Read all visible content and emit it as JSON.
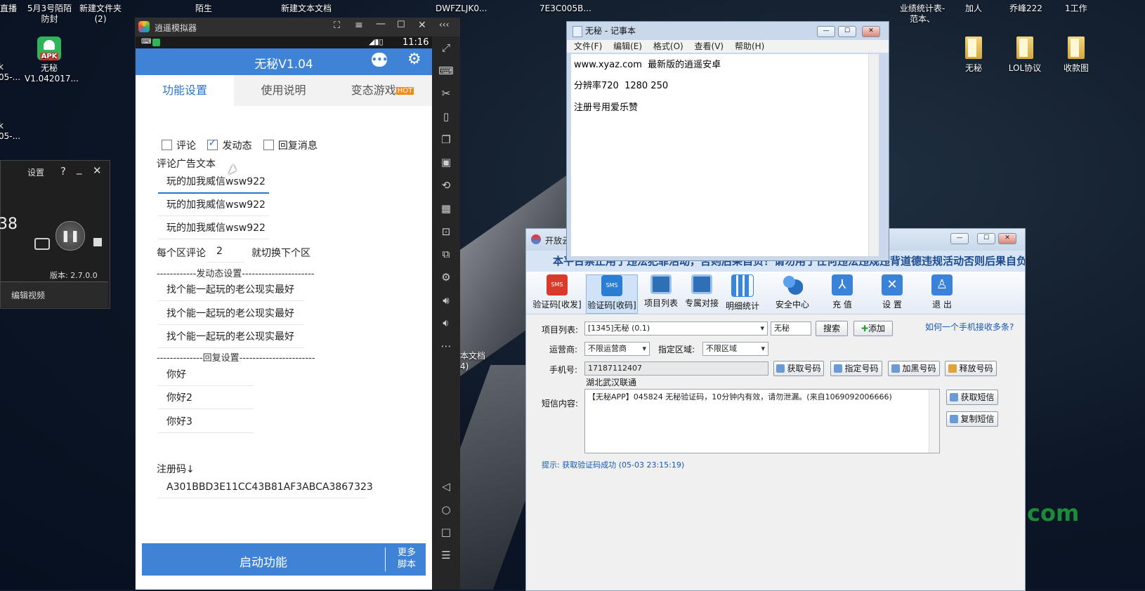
{
  "desktop": {
    "top_labels": [
      "直播",
      "5月3号陌陌\n防封",
      "新建文件夹\n(2)",
      "陌生",
      "新建文本文档",
      "DWFZLJK0...",
      "7E3C005B...",
      "业绩统计表-\n范本、",
      "加人",
      "乔峰222",
      "1工作"
    ],
    "left_icons": [
      {
        "label": "无秘\nV1.042017...",
        "icon": "apk-icon"
      }
    ],
    "right_icons": [
      {
        "label": "无秘"
      },
      {
        "label": "LOL协议"
      },
      {
        "label": "收款图"
      }
    ],
    "left_cut": [
      "k\n05-...",
      "k\n05-..."
    ],
    "mid_doc": "本文档\n4)",
    "watermark": "com"
  },
  "recorder": {
    "settings": "设置",
    "help": "?",
    "minimize": "_",
    "close": "✕",
    "time_digits": "38",
    "version": "版本: 2.7.0.0",
    "edit_video": "编辑视频"
  },
  "emulator": {
    "window_title": "逍遥模拟器",
    "status_time": "11:16",
    "app_title": "无秘V1.04",
    "tabs": [
      "功能设置",
      "使用说明",
      "变态游戏"
    ],
    "hot_badge": "HOT",
    "checkboxes": [
      {
        "label": "评论",
        "checked": false
      },
      {
        "label": "发动态",
        "checked": true
      },
      {
        "label": "回复消息",
        "checked": false
      }
    ],
    "comment_section_label": "评论广告文本",
    "comment_texts": [
      "玩的加我威信wsw922",
      "玩的加我威信wsw922",
      "玩的加我威信wsw922"
    ],
    "per_zone_prefix": "每个区评论",
    "per_zone_value": "2",
    "per_zone_suffix": "就切换下个区",
    "post_section_label": "------------发动态设置----------------------",
    "post_texts": [
      "找个能一起玩的老公现实最好",
      "找个能一起玩的老公现实最好",
      "找个能一起玩的老公现实最好"
    ],
    "reply_section_label": "--------------回复设置-----------------------",
    "reply_texts": [
      "你好",
      "你好2",
      "你好3"
    ],
    "reg_label": "注册码↓",
    "reg_code": "A301BBD3E11CC43B81AF3ABCA3867323",
    "start_button": "启动功能",
    "more_scripts": "更多\n脚本"
  },
  "notepad": {
    "title": "无秘 - 记事本",
    "menu": [
      "文件(F)",
      "编辑(E)",
      "格式(O)",
      "查看(V)",
      "帮助(H)"
    ],
    "lines": [
      "www.xyaz.com  最新版的逍遥安卓",
      "分辨率720  1280 250",
      "注册号用爱乐赞"
    ]
  },
  "sms_tool": {
    "title": "开放云",
    "banner": "本平台禁止用于违法犯罪活动，否则后果自负！请勿用于任何违法违规违背道德违规活动否则后果自负!",
    "tools": [
      {
        "label": "验证码[收发]",
        "icon": "sms-red-icon"
      },
      {
        "label": "验证码[收码]",
        "icon": "sms-blue-icon"
      },
      {
        "label": "项目列表",
        "icon": "monitor-icon"
      },
      {
        "label": "专属对接",
        "icon": "monitor-icon"
      },
      {
        "label": "明细统计",
        "icon": "bar-chart-icon"
      },
      {
        "label": "安全中心",
        "icon": "users-icon"
      },
      {
        "label": "充 值",
        "icon": "pdf-icon"
      },
      {
        "label": "设 置",
        "icon": "tools-icon"
      },
      {
        "label": "退 出",
        "icon": "person-icon"
      }
    ],
    "project_label": "项目列表:",
    "project_value": "[1345]无秘 (0.1)",
    "search_value": "无秘",
    "search_btn": "搜索",
    "add_btn": "添加",
    "help_link": "如何一个手机接收多条?",
    "carrier_label": "运营商:",
    "carrier_value": "不限运营商",
    "region_label": "指定区域:",
    "region_value": "不限区域",
    "phone_label": "手机号:",
    "phone_value": "17187112407",
    "phone_location": "湖北武汉联通",
    "get_number": "获取号码",
    "assign_number": "指定号码",
    "blacklist_number": "加黑号码",
    "release_number": "释放号码",
    "sms_label": "短信内容:",
    "sms_content": "【无秘APP】045824 无秘验证码，10分钟内有效，请勿泄漏。(来自1069092006666)",
    "get_sms": "获取短信",
    "copy_sms": "复制短信",
    "hint": "提示: 获取验证码成功 (05-03 23:15:19)"
  }
}
